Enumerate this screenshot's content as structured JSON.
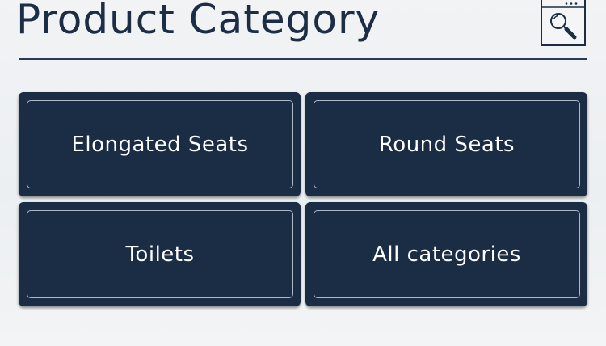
{
  "header": {
    "title": "Product Category",
    "search_icon": "search-window-icon"
  },
  "categories": [
    {
      "label": "Elongated Seats"
    },
    {
      "label": "Round Seats"
    },
    {
      "label": "Toilets"
    },
    {
      "label": "All categories"
    }
  ],
  "colors": {
    "navy": "#1b2c45",
    "title_text": "#1c2e45",
    "tile_border": "#aeb9c6",
    "background": "#eef1f3"
  }
}
